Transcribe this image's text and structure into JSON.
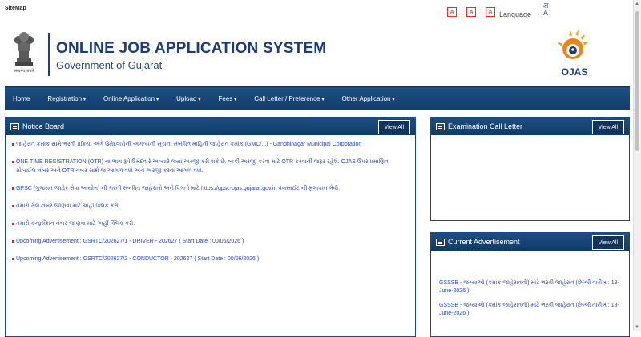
{
  "topbar": {
    "sitemap_label": "SiteMap",
    "font_buttons": [
      "A",
      "A",
      "A"
    ],
    "language_label": "Language",
    "language_icon_text": "अ A"
  },
  "header": {
    "title": "ONLINE JOB APPLICATION SYSTEM",
    "subtitle": "Government of Gujarat",
    "emblem_caption": "सत्यमेव जयते",
    "logo_text": "OJAS"
  },
  "nav": {
    "items": [
      {
        "label": "Home",
        "caret": ""
      },
      {
        "label": "Registration",
        "caret": "▾"
      },
      {
        "label": "Online Application",
        "caret": "▾"
      },
      {
        "label": "Upload",
        "caret": "▾"
      },
      {
        "label": "Fees",
        "caret": "▾"
      },
      {
        "label": "Call Letter / Preference",
        "caret": "▾"
      },
      {
        "label": "Other Application",
        "caret": "▾"
      }
    ]
  },
  "notice_board": {
    "title": "Notice Board",
    "view_all": "View All",
    "items": [
      "જાહેરાત ક્રમાંક સામે ભરતી પ્રક્રિયા અંગે ઉમેદવારોની અગત્યની સૂચના સંબંધિત માહિતી જાહેરાત ક્રમાંક (GMC/...) - Gandhinagar Municipal Corporation",
      "ONE TIME REGISTRATION (OTR) ના ભાગ રૂપે ઉમેદવારે અત્યારે જ્યાં અરજી કરી શકે છે. બાકી અરજી કરવા માટે OTR કરવાની જરૂર રહેશે. OJAS ઉપર પ્રમાણિત મોબાઈલ નંબર અને OTR નંબર સાથે જ આગળ વધો અને અરજી કરવા આગળ વધો.",
      "GPSC (ગુજરાત જાહેર સેવા આયોગ) ની ભરતી સંબંધિત જાહેરાતો અને વિગતો માટે https://gpsc-ojas.gujarat.gov.in વેબસાઈટ ની મુલાકાત લેવી.",
      "તમારો રોલ નંબર જાણવા માટે અહીં ક્લિક કરો.",
      "તમારો કન્ફર્મેશન નંબર જાણવા માટે અહીં ક્લિક કરો.",
      "Upcoming Advertisement : GSRTC/202627/1 - DRIVER - 202627 ( Start Date : 00/06/2026 )",
      "Upcoming Advertisement : GSRTC/202627/2 - CONDUCTOR - 202627 ( Start Date : 00/06/2026 )"
    ]
  },
  "exam_call_letter": {
    "title": "Examination Call Letter",
    "view_all": "View All"
  },
  "current_advertisement": {
    "title": "Current Advertisement",
    "view_all": "View All",
    "items": [
      "GSSSB - જગ્યાઓ (ક્રમાંક જાહેરાતની) માટે ભરતી જાહેરાત (છેલ્લી તારીખ : 18-June-2026 )",
      "GSSSB - જગ્યાઓ (ક્રમાંક જાહેરાતની) માટે ભરતી જાહેરાત (છેલ્લી તારીખ : 18-June-2026 )"
    ]
  },
  "colors": {
    "nav_bg": "#1c4f82",
    "title_color": "#1c3d78",
    "link_color": "#2a4aa8",
    "bullet_color": "#d22222"
  }
}
